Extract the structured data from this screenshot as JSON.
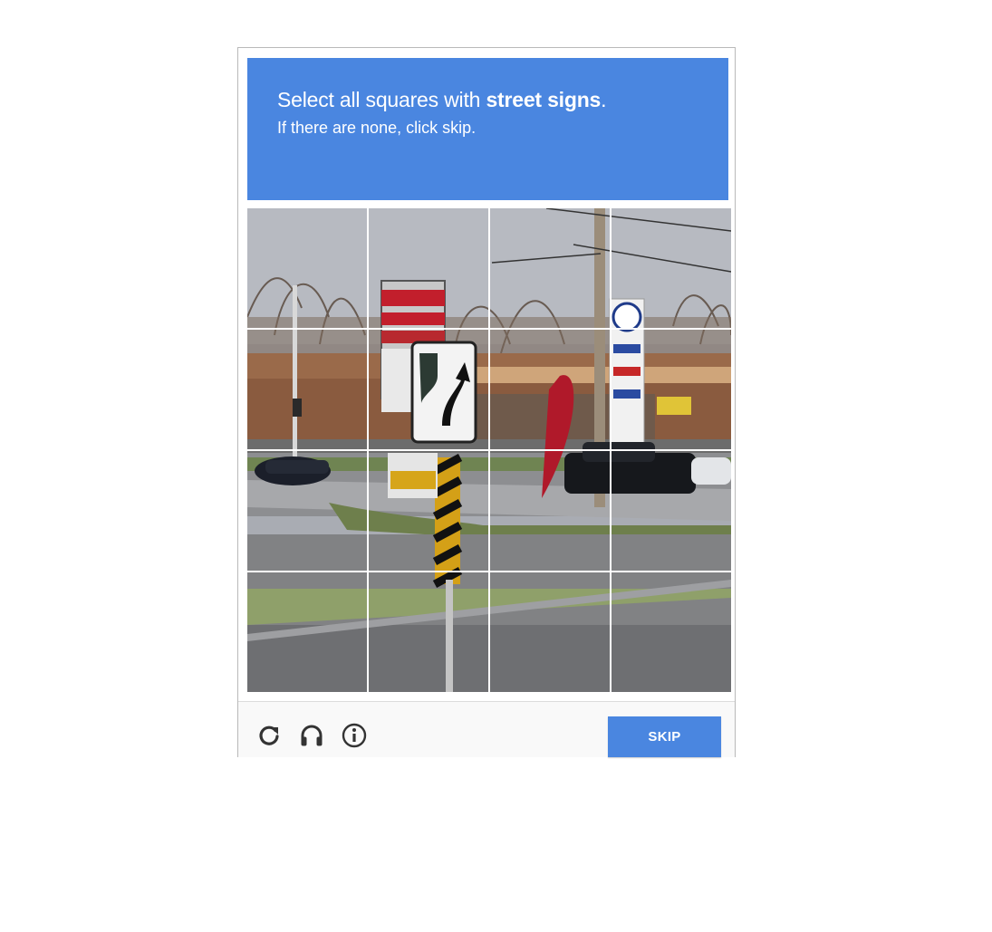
{
  "challenge": {
    "instruction_prefix": "Select all squares with",
    "instruction_target": "street signs",
    "instruction_suffix": ".",
    "subtext": "If there are none, click skip."
  },
  "grid": {
    "rows": 4,
    "columns": 4
  },
  "footer": {
    "reload_icon": "reload-icon",
    "audio_icon": "headphones-icon",
    "info_icon": "info-icon",
    "skip_label": "SKIP"
  },
  "colors": {
    "accent": "#4a86e0",
    "button_text": "#ffffff"
  }
}
